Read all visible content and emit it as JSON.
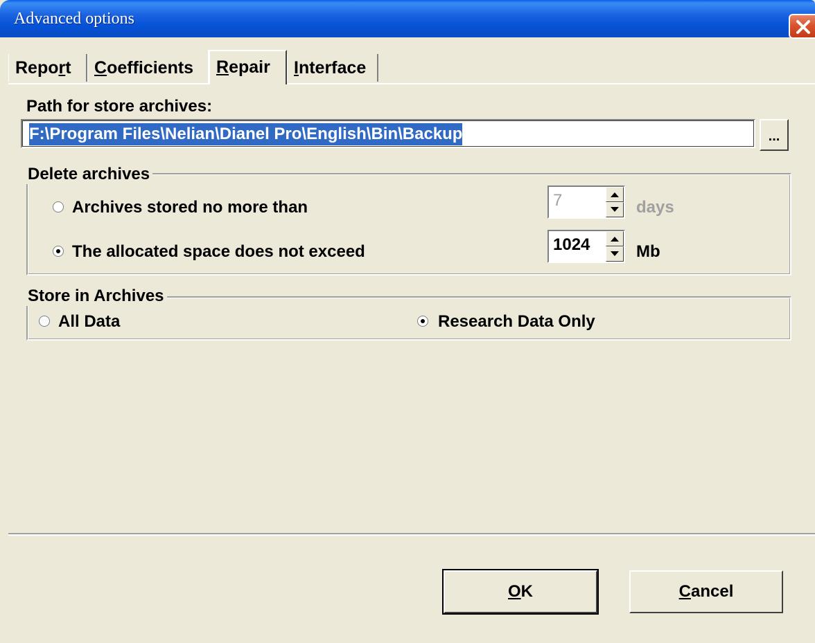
{
  "window": {
    "title": "Advanced options"
  },
  "tabs": [
    {
      "label_pre": "Repo",
      "label_u": "r",
      "label_post": "t",
      "active": false
    },
    {
      "label_pre": "",
      "label_u": "C",
      "label_post": "oefficients",
      "active": false
    },
    {
      "label_pre": "",
      "label_u": "R",
      "label_post": "epair",
      "active": true
    },
    {
      "label_pre": "",
      "label_u": "I",
      "label_post": "nterface",
      "active": false
    }
  ],
  "path": {
    "label": "Path for store archives:",
    "value": "F:\\Program Files\\Nelian\\Dianel Pro\\English\\Bin\\Backup",
    "browse_label": "..."
  },
  "delete_archives": {
    "legend": "Delete archives",
    "option_days": {
      "label": "Archives stored no more than",
      "selected": false,
      "value": "7",
      "unit": "days",
      "enabled": false
    },
    "option_space": {
      "label": "The allocated space does not exceed",
      "selected": true,
      "value": "1024",
      "unit": "Mb",
      "enabled": true
    }
  },
  "store_in_archives": {
    "legend": "Store in Archives",
    "option_all": {
      "label": "All Data",
      "selected": false
    },
    "option_research": {
      "label": "Research Data Only",
      "selected": true
    }
  },
  "buttons": {
    "ok_u": "O",
    "ok_post": "K",
    "cancel_u": "C",
    "cancel_post": "ancel"
  },
  "colors": {
    "titlebar": "#0552d6",
    "selection": "#316ac5",
    "window_bg": "#ece9d8",
    "close": "#d9542e"
  }
}
